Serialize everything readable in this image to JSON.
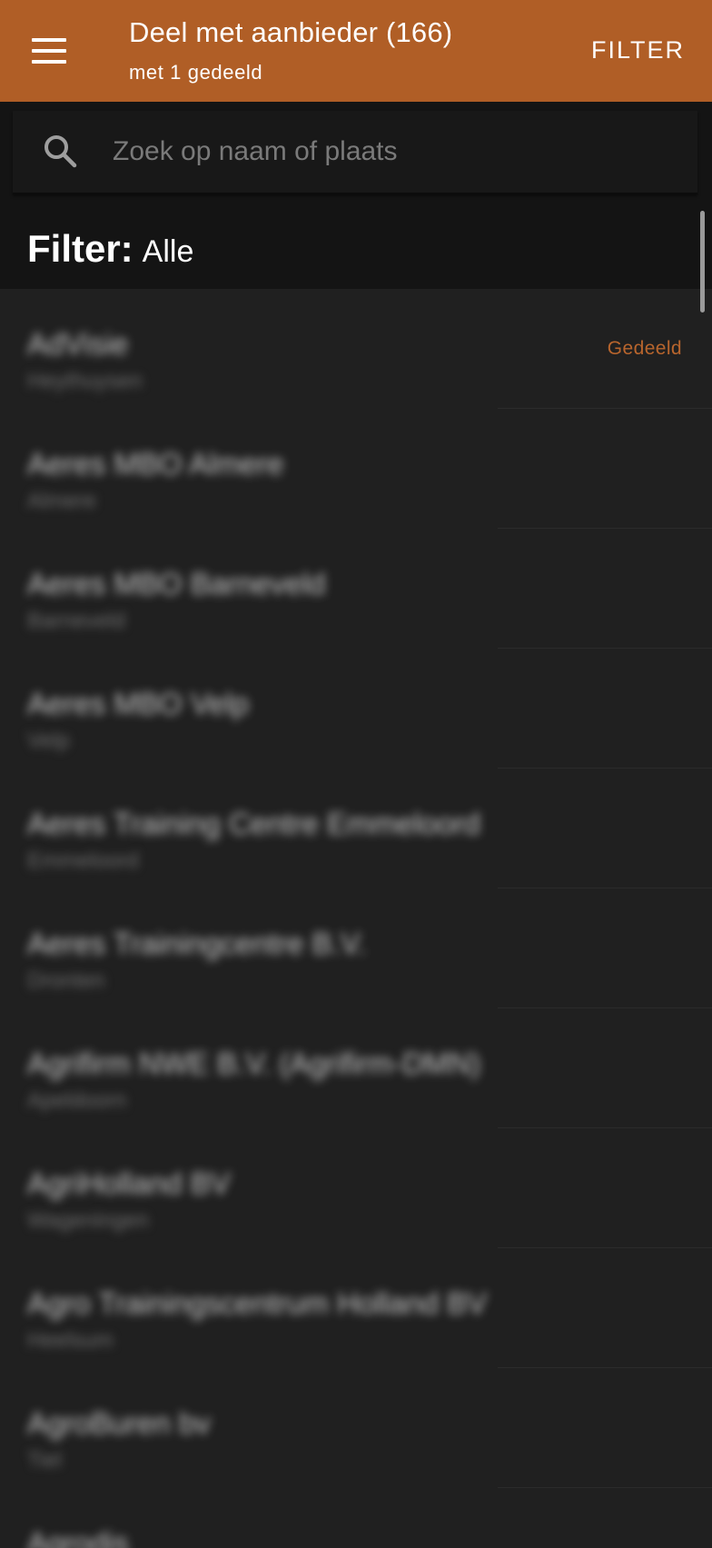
{
  "appbar": {
    "title": "Deel met aanbieder (166)",
    "subtitle": "met 1 gedeeld",
    "filter_action": "FILTER",
    "menu_icon": "hamburger-menu-icon",
    "color": "#b05e26"
  },
  "search": {
    "placeholder": "Zoek op naam of plaats",
    "value": "",
    "icon": "search-icon"
  },
  "filter": {
    "label": "Filter:",
    "value": "Alle"
  },
  "theme": {
    "background": "#202020",
    "accent": "#b8652d"
  },
  "providers": [
    {
      "name": "AdVisie",
      "city": "Heythuysen",
      "status": "Gedeeld"
    },
    {
      "name": "Aeres MBO Almere",
      "city": "Almere",
      "status": ""
    },
    {
      "name": "Aeres MBO Barneveld",
      "city": "Barneveld",
      "status": ""
    },
    {
      "name": "Aeres MBO Velp",
      "city": "Velp",
      "status": ""
    },
    {
      "name": "Aeres Training Centre Emmeloord",
      "city": "Emmeloord",
      "status": ""
    },
    {
      "name": "Aeres Trainingcentre B.V.",
      "city": "Dronten",
      "status": ""
    },
    {
      "name": "Agrifirm NWE B.V. (Agrifirm-DMN)",
      "city": "Apeldoorn",
      "status": ""
    },
    {
      "name": "AgriHolland BV",
      "city": "Wageningen",
      "status": ""
    },
    {
      "name": "Agro Trainingscentrum Holland BV",
      "city": "Heelsum",
      "status": ""
    },
    {
      "name": "AgroBuren bv",
      "city": "Tiel",
      "status": ""
    },
    {
      "name": "Agrodis",
      "city": "",
      "status": ""
    }
  ]
}
